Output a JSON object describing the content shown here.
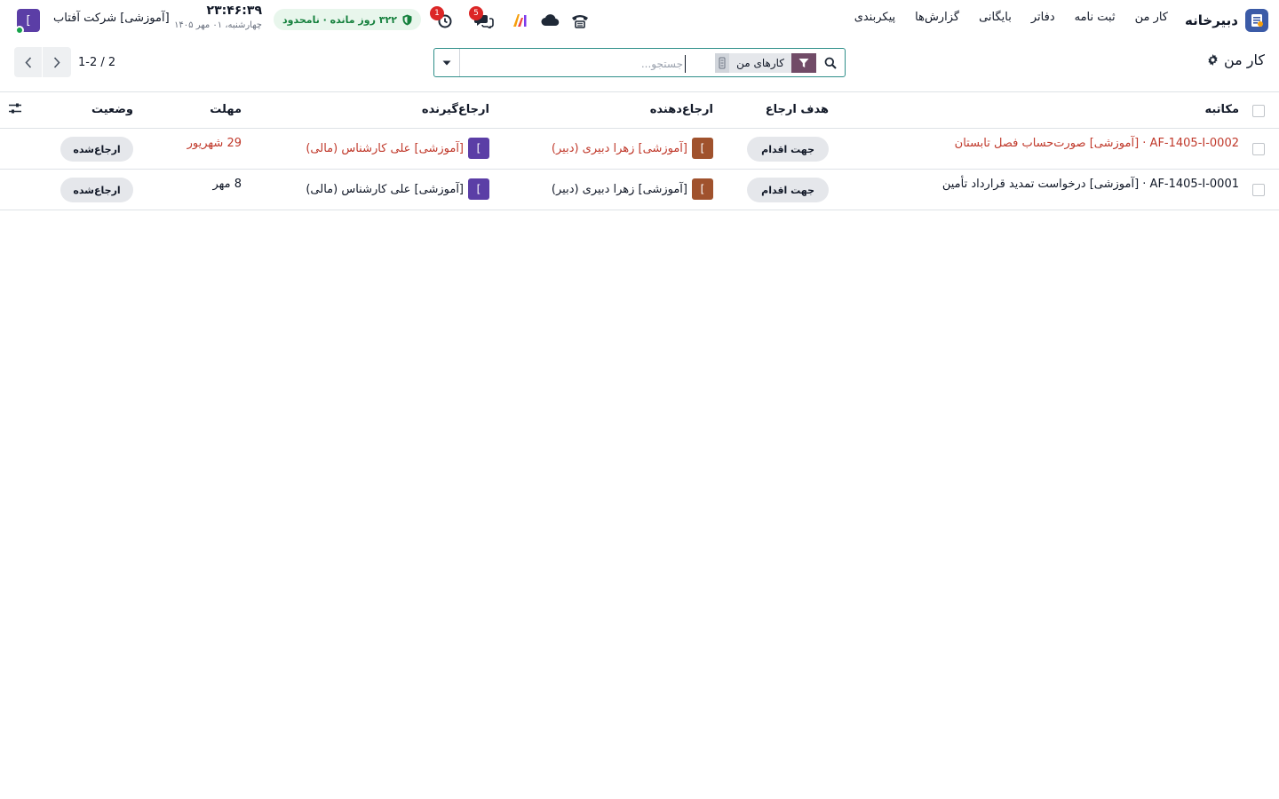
{
  "navbar": {
    "brand": "دبیرخانه",
    "menu": [
      "کار من",
      "ثبت نامه",
      "دفاتر",
      "بایگانی",
      "گزارش‌ها",
      "پیکربندی"
    ],
    "icons": [
      "phone-icon",
      "cloud-icon",
      "ai-logo-icon",
      "chat-icon",
      "activity-clock-icon"
    ],
    "chat_badge": "5",
    "activity_badge": "1",
    "trial": "۳۲۲ روز مانده · نامحدود",
    "clock_time": "۲۳:۴۶:۳۹",
    "clock_date": "چهارشنبه، ۰۱ مهر ۱۴۰۵",
    "company": "[آموزشی] شرکت آفتاب",
    "company_avatar": "]"
  },
  "control": {
    "title": "کار من",
    "facet": "کارهای من",
    "search_placeholder": "جستجو...",
    "pager": "1-2 / 2"
  },
  "table": {
    "headers": {
      "subject": "مکاتبه",
      "purpose": "هدف ارجاع",
      "sender": "ارجاع‌دهنده",
      "receiver": "ارجاع‌گیرنده",
      "deadline": "مهلت",
      "status": "وضعیت"
    },
    "rows": [
      {
        "subject": "AF-1405-I-0002 · [آموزشی] صورت‌حساب فصل تابستان",
        "purpose": "جهت اقدام",
        "sender": "[آموزشی] زهرا دبیری (دبیر)",
        "sender_avatar": "]",
        "receiver": "[آموزشی] علی کارشناس (مالی)",
        "receiver_avatar": "]",
        "deadline": "29 شهریور",
        "status": "ارجاع‌شده"
      },
      {
        "subject": "AF-1405-I-0001 · [آموزشی] درخواست تمدید قرارداد تأمین",
        "purpose": "جهت اقدام",
        "sender": "[آموزشی] زهرا دبیری (دبیر)",
        "sender_avatar": "]",
        "receiver": "[آموزشی] علی کارشناس (مالی)",
        "receiver_avatar": "]",
        "deadline": "8 مهر",
        "status": "ارجاع‌شده"
      }
    ]
  },
  "colors": {
    "overdue": "#c0392b",
    "sender_avatar": "#a0522d",
    "receiver_avatar": "#5b3ea6",
    "facet": "#714b67",
    "brand": "#3b5ba7"
  }
}
